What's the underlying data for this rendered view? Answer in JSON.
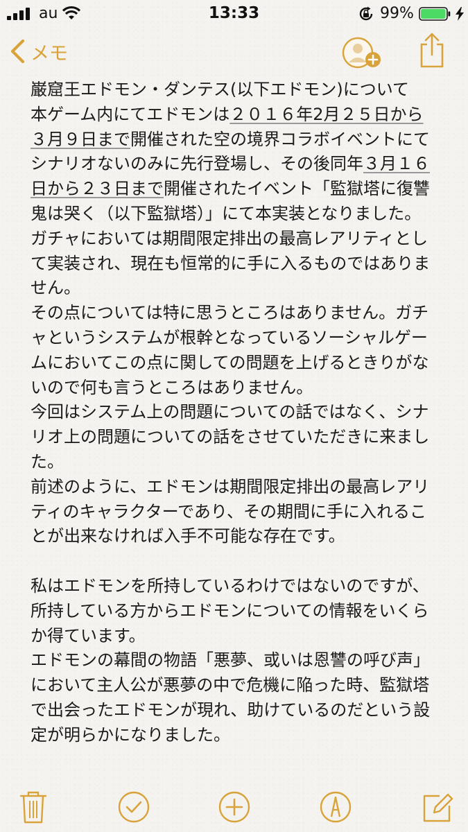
{
  "status_bar": {
    "carrier": "au",
    "time": "13:33",
    "battery_percent": "99%",
    "battery_level": 0.99
  },
  "nav": {
    "back_label": "メモ",
    "accent_color": "#d8a33a"
  },
  "note": {
    "lines": [
      "巌窟王エドモン・ダンテス(以下エドモン)について",
      "本ゲーム内にてエドモンは",
      "２０１６年2月２５日から",
      "３月９日まで",
      "開催された空の境界コラボイベントにて",
      "シナリオないのみに先行登場し、その後同年",
      "３月１６",
      "日から２３日まで",
      "開催されたイベント「監獄塔に復讐",
      "鬼は哭く（以下監獄塔）」にて本実装となりました。",
      "ガチャにおいては期間限定排出の最高レアリティとし",
      "て実装され、現在も恒常的に手に入るものではありま",
      "せん。",
      "その点については特に思うところはありません。ガチ",
      "ャというシステムが根幹となっているソーシャルゲー",
      "ムにおいてこの点に関しての問題を上げるときりがな",
      "いので何も言うところはありません。",
      "今回はシステム上の問題についての話ではなく、シナ",
      "リオ上の問題についての話をさせていただきに来まし",
      "た。",
      "前述のように、エドモンは期間限定排出の最高レアリ",
      "ティのキャラクターであり、その期間に手に入れるこ",
      "とが出来なければ入手不可能な存在です。",
      "私はエドモンを所持しているわけではないのですが、",
      "所持している方からエドモンについての情報をいくら",
      "か得ています。",
      "エドモンの幕間の物語「悪夢、或いは恩讐の呼び声」",
      "において主人公が悪夢の中で危機に陥った時、監獄塔",
      "で出会ったエドモンが現れ、助けているのだという設",
      "定が明らかになりました。"
    ]
  },
  "toolbar": {
    "icons": [
      "trash-icon",
      "checklist-icon",
      "add-icon",
      "sketch-icon",
      "compose-icon"
    ]
  }
}
